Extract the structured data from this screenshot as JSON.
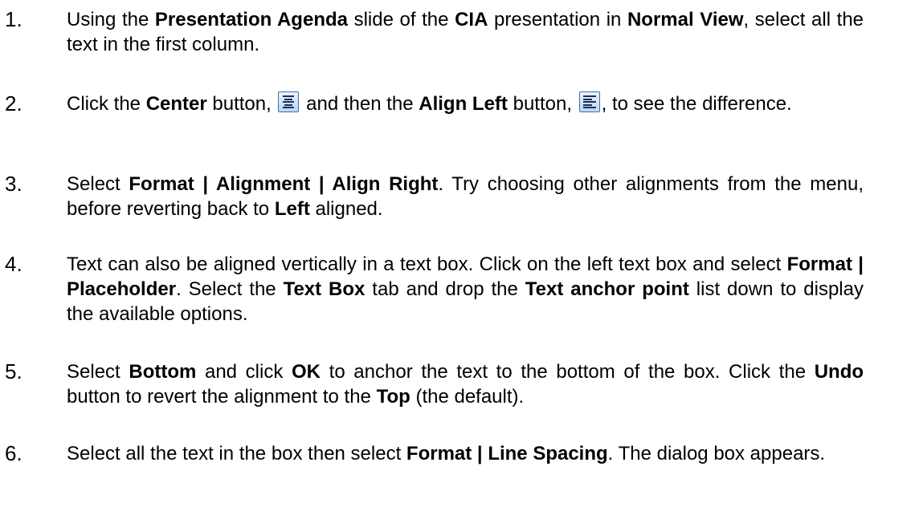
{
  "steps": [
    {
      "number": "1.",
      "segments": [
        {
          "t": "Using the "
        },
        {
          "t": "Presentation Agenda",
          "b": true
        },
        {
          "t": " slide of the "
        },
        {
          "t": "CIA",
          "b": true
        },
        {
          "t": " presentation in "
        },
        {
          "t": "Normal View",
          "b": true
        },
        {
          "t": ", select all the text in the first column."
        }
      ]
    },
    {
      "number": "2.",
      "segments": [
        {
          "t": "Click the "
        },
        {
          "t": "Center",
          "b": true
        },
        {
          "t": " button, "
        },
        {
          "icon": "center-align-icon"
        },
        {
          "t": " and then the "
        },
        {
          "t": "Align Left",
          "b": true
        },
        {
          "t": " button, "
        },
        {
          "icon": "align-left-icon"
        },
        {
          "t": ", to see the difference."
        }
      ]
    },
    {
      "number": "3.",
      "segments": [
        {
          "t": "Select "
        },
        {
          "t": "Format | Alignment | Align Right",
          "b": true
        },
        {
          "t": ". Try choosing other alignments from the menu, before reverting back to "
        },
        {
          "t": "Left",
          "b": true
        },
        {
          "t": " aligned."
        }
      ]
    },
    {
      "number": "4.",
      "segments": [
        {
          "t": "Text can also be aligned vertically in a text box. Click on the left text box and select "
        },
        {
          "t": "Format | Placeholder",
          "b": true
        },
        {
          "t": ". Select the "
        },
        {
          "t": "Text Box",
          "b": true
        },
        {
          "t": " tab and drop the "
        },
        {
          "t": "Text anchor point",
          "b": true
        },
        {
          "t": " list down to display the available options."
        }
      ]
    },
    {
      "number": "5.",
      "segments": [
        {
          "t": "Select "
        },
        {
          "t": "Bottom",
          "b": true
        },
        {
          "t": " and click "
        },
        {
          "t": "OK",
          "b": true
        },
        {
          "t": " to anchor the text to the bottom of the box. Click the "
        },
        {
          "t": "Undo",
          "b": true
        },
        {
          "t": " button to revert the alignment to the "
        },
        {
          "t": "Top",
          "b": true
        },
        {
          "t": " (the default)."
        }
      ]
    },
    {
      "number": "6.",
      "segments": [
        {
          "t": "Select all the text in the box then select "
        },
        {
          "t": "Format | Line Spacing",
          "b": true
        },
        {
          "t": ". The dialog box appears."
        }
      ]
    }
  ],
  "colors": {
    "text": "#000000",
    "icon_border": "#3f6fae",
    "icon_fill": "#cfe2f8",
    "icon_lines": "#1f2f55"
  }
}
